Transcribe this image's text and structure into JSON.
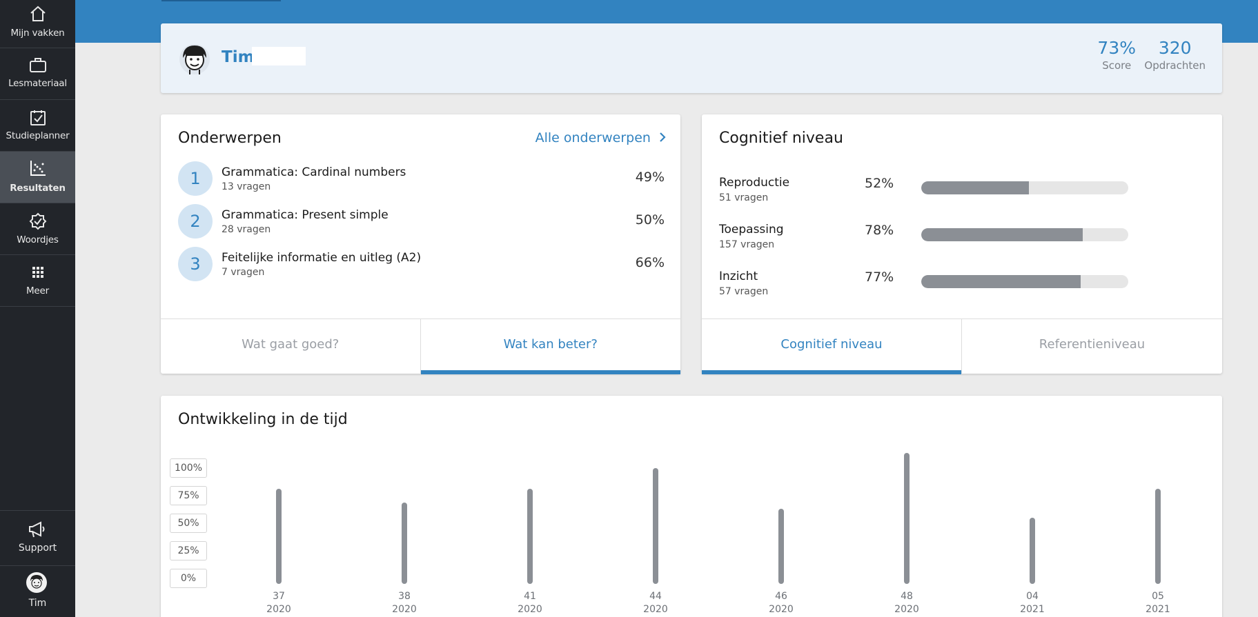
{
  "sidebar": {
    "items": [
      {
        "label": "Mijn vakken",
        "icon": "home-icon"
      },
      {
        "label": "Lesmateriaal",
        "icon": "briefcase-icon"
      },
      {
        "label": "Studieplanner",
        "icon": "calendar-check-icon"
      },
      {
        "label": "Resultaten",
        "icon": "scatter-chart-icon",
        "active": true
      },
      {
        "label": "Woordjes",
        "icon": "badge-check-icon"
      },
      {
        "label": "Meer",
        "icon": "grid-icon"
      }
    ],
    "support_label": "Support",
    "user_label": "Tim"
  },
  "profile": {
    "name": "Tim",
    "score_value": "73%",
    "score_label": "Score",
    "assignments_value": "320",
    "assignments_label": "Opdrachten"
  },
  "topics": {
    "title": "Onderwerpen",
    "all_link": "Alle onderwerpen",
    "items": [
      {
        "num": "1",
        "title": "Grammatica: Cardinal numbers",
        "sub": "13 vragen",
        "pct": "49%"
      },
      {
        "num": "2",
        "title": "Grammatica: Present simple",
        "sub": "28 vragen",
        "pct": "50%"
      },
      {
        "num": "3",
        "title": "Feitelijke informatie en uitleg (A2)",
        "sub": "7 vragen",
        "pct": "66%"
      }
    ],
    "tabs": {
      "left": "Wat gaat goed?",
      "right": "Wat kan beter?"
    }
  },
  "cognitive": {
    "title": "Cognitief niveau",
    "items": [
      {
        "title": "Reproductie",
        "sub": "51 vragen",
        "pct": "52%",
        "value": 52
      },
      {
        "title": "Toepassing",
        "sub": "157 vragen",
        "pct": "78%",
        "value": 78
      },
      {
        "title": "Inzicht",
        "sub": "57 vragen",
        "pct": "77%",
        "value": 77
      }
    ],
    "tabs": {
      "left": "Cognitief niveau",
      "right": "Referentieniveau"
    }
  },
  "chart_data": {
    "type": "bar",
    "title": "Ontwikkeling in de tijd",
    "y_ticks": [
      "100%",
      "75%",
      "50%",
      "25%",
      "0%"
    ],
    "ylim": [
      0,
      100
    ],
    "categories": [
      "37 2020",
      "38 2020",
      "41 2020",
      "44 2020",
      "46 2020",
      "48 2020",
      "04 2021",
      "05 2021"
    ],
    "x_week": [
      "37",
      "38",
      "41",
      "44",
      "46",
      "48",
      "04",
      "05"
    ],
    "x_year": [
      "2020",
      "2020",
      "2020",
      "2020",
      "2020",
      "2020",
      "2021",
      "2021"
    ],
    "values": [
      86,
      74,
      86,
      105,
      68,
      119,
      60,
      86
    ],
    "bar_color": "#8b8f95"
  },
  "colors": {
    "accent": "#3283c0",
    "sidebar": "#22252a"
  }
}
